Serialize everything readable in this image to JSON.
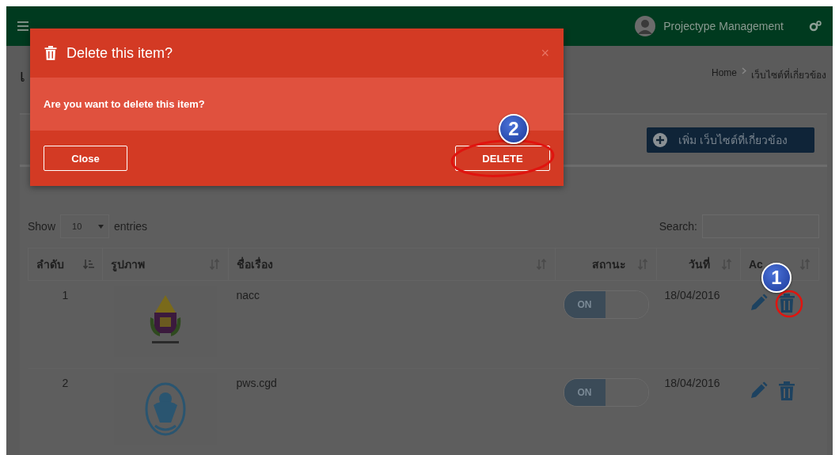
{
  "topbar": {
    "user": "Projectype Management"
  },
  "page": {
    "title": "เ",
    "breadcrumb": [
      "Home",
      "เว็บไซต์ที่เกี่ยวข้อง"
    ]
  },
  "add_button": {
    "label": "เพิ่ม เว็บไซต์ที่เกี่ยวข้อง"
  },
  "table_controls": {
    "show": "Show",
    "page_size": "10",
    "entries": "entries",
    "search_label": "Search:"
  },
  "table": {
    "columns": [
      {
        "label": "ลำดับ",
        "sorted": true
      },
      {
        "label": "รูปภาพ",
        "sorted": false
      },
      {
        "label": "ชื่อเรื่อง",
        "sorted": false
      },
      {
        "label": "สถานะ",
        "sorted": false
      },
      {
        "label": "วันที่",
        "sorted": false
      },
      {
        "label": "Ac",
        "sorted": false
      }
    ],
    "rows": [
      {
        "index": "1",
        "title": "nacc",
        "status": {
          "label": "ON",
          "on": true
        },
        "date": "18/04/2016"
      },
      {
        "index": "2",
        "title": "pws.cgd",
        "status": {
          "label": "ON",
          "on": true
        },
        "date": "18/04/2016"
      }
    ]
  },
  "modal": {
    "title": "Delete this item?",
    "close": "×",
    "message": "Are you want to delete this item?",
    "buttons": [
      "Close",
      "DELETE"
    ]
  },
  "annotations": [
    {
      "number": "1"
    },
    {
      "number": "2"
    }
  ]
}
